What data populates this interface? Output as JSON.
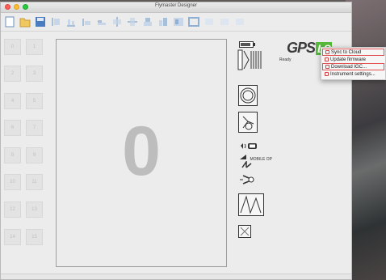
{
  "window": {
    "title": "Flymaster Designer"
  },
  "pages": [
    "0",
    "1",
    "2",
    "3",
    "4",
    "5",
    "6",
    "7",
    "8",
    "9",
    "10",
    "11",
    "12",
    "13",
    "14",
    "15"
  ],
  "canvas": {
    "big_value": "0"
  },
  "device": {
    "brand": "GPS",
    "brand_suffix": "LS",
    "status": "Ready"
  },
  "palette": {
    "signal_label": "MOBILE OP"
  },
  "menu": {
    "items": [
      {
        "label": "Sync to Cloud",
        "icon": "cloud-sync-icon"
      },
      {
        "label": "Update firmware",
        "icon": "firmware-icon"
      },
      {
        "label": "Download IGC...",
        "icon": "download-icon"
      },
      {
        "label": "Instrument settings...",
        "icon": "settings-icon"
      }
    ]
  },
  "colors": {
    "menu_highlight": "#e05050",
    "brand_green": "#55b93a"
  }
}
